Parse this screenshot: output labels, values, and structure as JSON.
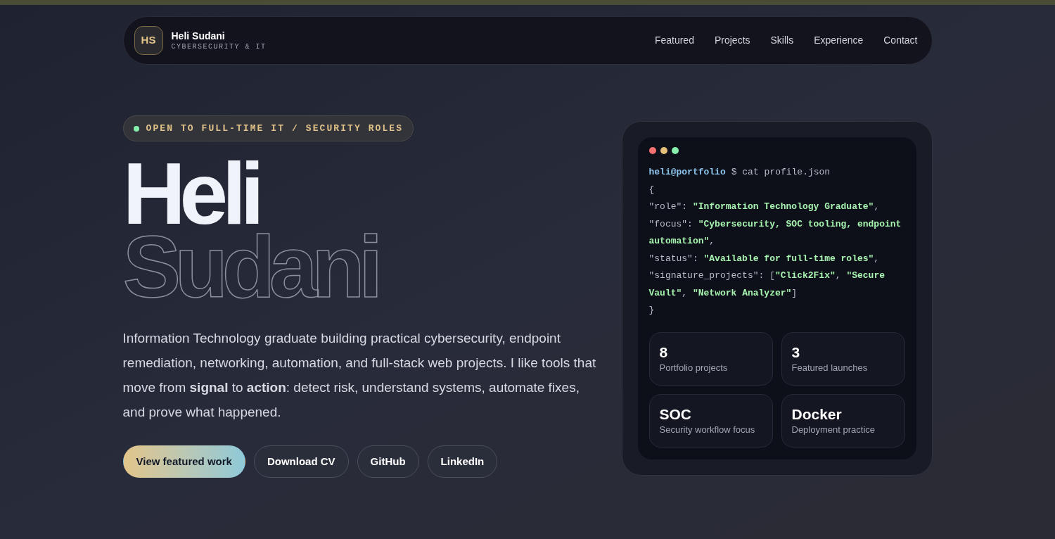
{
  "nav": {
    "logo": "HS",
    "name": "Heli Sudani",
    "tagline": "CYBERSECURITY & IT",
    "links": [
      {
        "label": "Featured"
      },
      {
        "label": "Projects"
      },
      {
        "label": "Skills"
      },
      {
        "label": "Experience"
      },
      {
        "label": "Contact"
      }
    ]
  },
  "hero": {
    "badge": {
      "label": "OPEN TO FULL-TIME IT / SECURITY ROLES",
      "color": "#86efac"
    },
    "first_name": "Heli",
    "last_name": "Sudani",
    "intro": "Information Technology graduate building practical cybersecurity, endpoint remediation, networking, automation, and full-stack web projects. I like tools that move from **signal** to **action**: detect risk, understand systems, automate fixes, and prove what happened.",
    "buttons": [
      {
        "label": "View featured work",
        "kind": "primary"
      },
      {
        "label": "Download CV",
        "kind": "outline"
      },
      {
        "label": "GitHub",
        "kind": "outline"
      },
      {
        "label": "LinkedIn",
        "kind": "outline"
      }
    ]
  },
  "terminal": {
    "dots": [
      {
        "color": "#f87171"
      },
      {
        "color": "#e5c07b"
      },
      {
        "color": "#86efac"
      }
    ],
    "prompt_user": "heli@portfolio",
    "prompt_command": "$ cat profile.json",
    "lines": [
      [
        {
          "kind": "punct",
          "text": "{"
        }
      ],
      [
        {
          "kind": "key",
          "text": "\"role\": "
        },
        {
          "kind": "string",
          "text": "\"Information Technology Graduate\""
        },
        {
          "kind": "punct",
          "text": ","
        }
      ],
      [
        {
          "kind": "key",
          "text": "\"focus\": "
        },
        {
          "kind": "string",
          "text": "\"Cybersecurity, SOC tooling, endpoint automation\""
        },
        {
          "kind": "punct",
          "text": ","
        }
      ],
      [
        {
          "kind": "key",
          "text": "\"status\": "
        },
        {
          "kind": "string",
          "text": "\"Available for full-time roles\""
        },
        {
          "kind": "punct",
          "text": ","
        }
      ],
      [
        {
          "kind": "key",
          "text": "\"signature_projects\": "
        },
        {
          "kind": "punct",
          "text": "["
        },
        {
          "kind": "string",
          "text": "\"Click2Fix\""
        },
        {
          "kind": "punct",
          "text": ", "
        },
        {
          "kind": "string",
          "text": "\"Secure Vault\""
        },
        {
          "kind": "punct",
          "text": ", "
        },
        {
          "kind": "string",
          "text": "\"Network Analyzer\""
        },
        {
          "kind": "punct",
          "text": "]"
        }
      ],
      [
        {
          "kind": "punct",
          "text": "}"
        }
      ]
    ],
    "stats": [
      {
        "value": "8",
        "label": "Portfolio projects"
      },
      {
        "value": "3",
        "label": "Featured launches"
      },
      {
        "value": "SOC",
        "label": "Security workflow focus"
      },
      {
        "value": "Docker",
        "label": "Deployment practice"
      }
    ]
  }
}
